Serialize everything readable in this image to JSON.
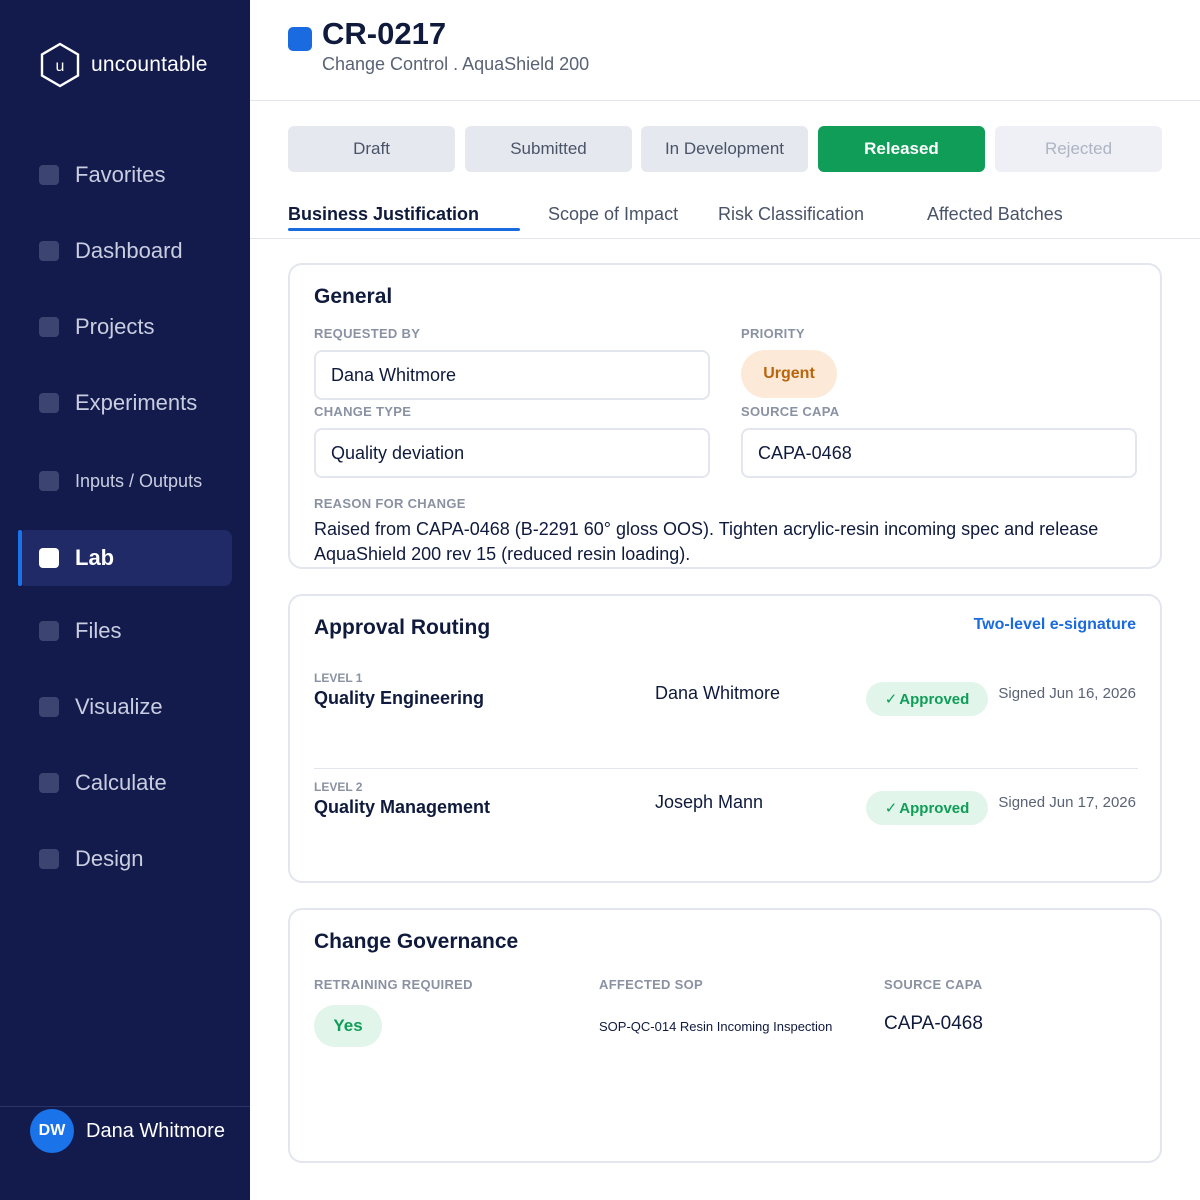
{
  "sidebar": {
    "brand": "uncountable",
    "logo_letter": "u",
    "items": [
      {
        "label": "Favorites"
      },
      {
        "label": "Dashboard"
      },
      {
        "label": "Projects"
      },
      {
        "label": "Experiments"
      },
      {
        "label": "Inputs / Outputs"
      },
      {
        "label": "Lab",
        "active": true
      },
      {
        "label": "Files"
      },
      {
        "label": "Visualize"
      },
      {
        "label": "Calculate"
      },
      {
        "label": "Design"
      }
    ],
    "user": {
      "initials": "DW",
      "name": "Dana Whitmore"
    }
  },
  "header": {
    "title": "CR-0217",
    "subtitle": "Change Control . AquaShield 200"
  },
  "statuses": [
    {
      "label": "Draft",
      "state": "default"
    },
    {
      "label": "Submitted",
      "state": "default"
    },
    {
      "label": "In Development",
      "state": "default"
    },
    {
      "label": "Released",
      "state": "active"
    },
    {
      "label": "Rejected",
      "state": "muted"
    }
  ],
  "tabs": [
    {
      "label": "Business Justification",
      "active": true
    },
    {
      "label": "Scope of Impact"
    },
    {
      "label": "Risk Classification"
    },
    {
      "label": "Affected Batches"
    }
  ],
  "general": {
    "title": "General",
    "requested_by_label": "REQUESTED BY",
    "requested_by": "Dana Whitmore",
    "priority_label": "PRIORITY",
    "priority": "Urgent",
    "change_type_label": "CHANGE TYPE",
    "change_type": "Quality deviation",
    "source_capa_label": "SOURCE CAPA",
    "source_capa": "CAPA-0468",
    "reason_label": "REASON FOR CHANGE",
    "reason": "Raised from CAPA-0468 (B-2291 60° gloss OOS). Tighten acrylic-resin incoming spec and release AquaShield 200 rev 15 (reduced resin loading)."
  },
  "approval": {
    "title": "Approval Routing",
    "link": "Two-level e-signature",
    "levels": [
      {
        "level": "LEVEL 1",
        "name": "Quality Engineering",
        "signer": "Dana Whitmore",
        "status": "Approved",
        "check": "✓",
        "signed": "Signed Jun 16, 2026"
      },
      {
        "level": "LEVEL 2",
        "name": "Quality Management",
        "signer": "Joseph Mann",
        "status": "Approved",
        "check": "✓",
        "signed": "Signed Jun 17, 2026"
      }
    ]
  },
  "governance": {
    "title": "Change Governance",
    "retraining_label": "RETRAINING REQUIRED",
    "retraining": "Yes",
    "sop_label": "AFFECTED SOP",
    "sop": "SOP-QC-014 Resin Incoming Inspection",
    "capa_label": "SOURCE CAPA",
    "capa": "CAPA-0468"
  }
}
